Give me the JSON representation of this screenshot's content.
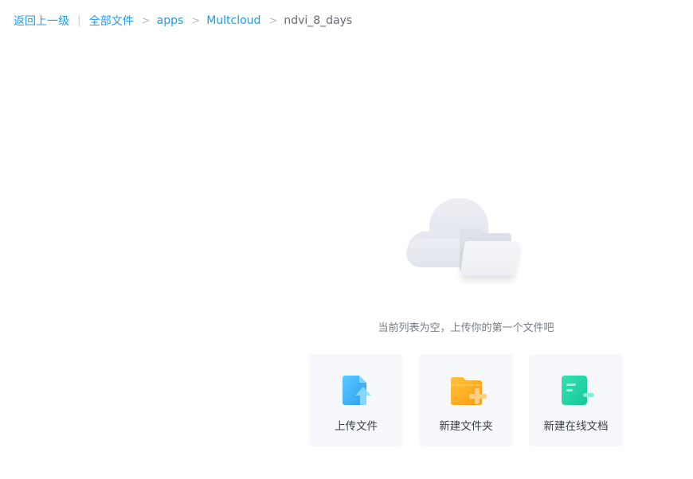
{
  "breadcrumb": {
    "back_label": "返回上一级",
    "divider": "|",
    "separator": ">",
    "items": [
      {
        "label": "全部文件"
      },
      {
        "label": "apps"
      },
      {
        "label": "Multcloud"
      },
      {
        "label": "ndvi_8_days"
      }
    ]
  },
  "empty_state": {
    "message": "当前列表为空，上传你的第一个文件吧",
    "illustration": "cloud-folder-icon"
  },
  "actions": [
    {
      "label": "上传文件",
      "icon": "upload-file-icon",
      "color": "#3bb4ff"
    },
    {
      "label": "新建文件夹",
      "icon": "new-folder-icon",
      "color": "#ffac1d"
    },
    {
      "label": "新建在线文档",
      "icon": "new-online-doc-icon",
      "color": "#21d9a5"
    }
  ]
}
